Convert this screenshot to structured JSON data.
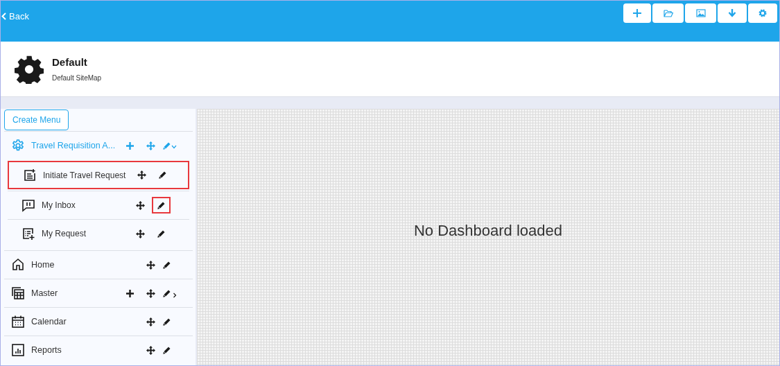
{
  "top_bar": {
    "back": "Back",
    "tools": [
      {
        "kind": "add"
      },
      {
        "kind": "open"
      },
      {
        "kind": "image"
      },
      {
        "kind": "download"
      },
      {
        "kind": "settings"
      }
    ]
  },
  "header": {
    "title": "Default",
    "subtitle": "Default SiteMap"
  },
  "sidebar": {
    "create_button": "Create Menu",
    "items": [
      {
        "label": "Travel Requisition A...",
        "kind": "gear",
        "selected": true,
        "can_add": true,
        "expanded": true,
        "children": [
          {
            "label": "Initiate Travel Request",
            "kind": "document",
            "highlighted": true,
            "edit_highlighted": false
          },
          {
            "label": "My Inbox",
            "kind": "chat",
            "highlighted": false,
            "edit_highlighted": true
          },
          {
            "label": "My Request",
            "kind": "checklist",
            "highlighted": false,
            "edit_highlighted": false
          }
        ]
      },
      {
        "label": "Home",
        "kind": "home",
        "selected": false,
        "can_add": false
      },
      {
        "label": "Master",
        "kind": "grid",
        "selected": false,
        "can_add": true,
        "expanded": false
      },
      {
        "label": "Calendar",
        "kind": "calendar",
        "selected": false,
        "can_add": false
      },
      {
        "label": "Reports",
        "kind": "chart",
        "selected": false,
        "can_add": false
      }
    ]
  },
  "main": {
    "message": "No Dashboard loaded"
  }
}
